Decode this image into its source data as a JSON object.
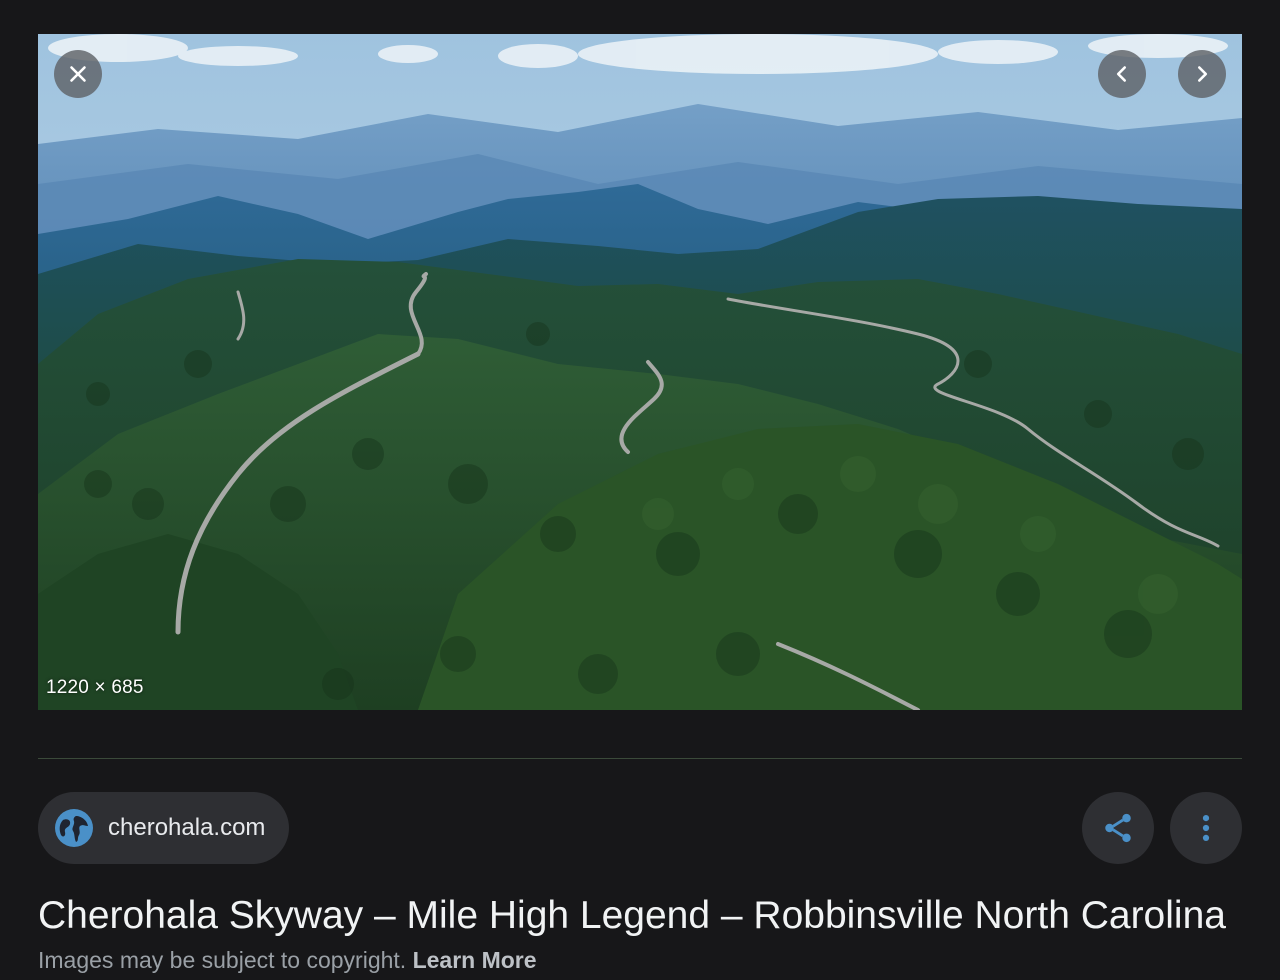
{
  "image": {
    "alt": "",
    "dimensions_label": "1220 × 685"
  },
  "controls": {
    "close_icon": "close-icon",
    "prev_icon": "chevron-left-icon",
    "next_icon": "chevron-right-icon"
  },
  "source": {
    "domain": "cherohala.com",
    "icon": "globe-icon"
  },
  "actions": {
    "share_icon": "share-icon",
    "more_icon": "more-vert-icon"
  },
  "result": {
    "title": "Cherohala Skyway – Mile High Legend – Robbinsville North Carolina",
    "copyright_text": "Images may be subject to copyright.",
    "learn_more": "Learn More"
  },
  "colors": {
    "background": "#171719",
    "chip": "#2e2f33",
    "accent_blue": "#4a90c8"
  }
}
